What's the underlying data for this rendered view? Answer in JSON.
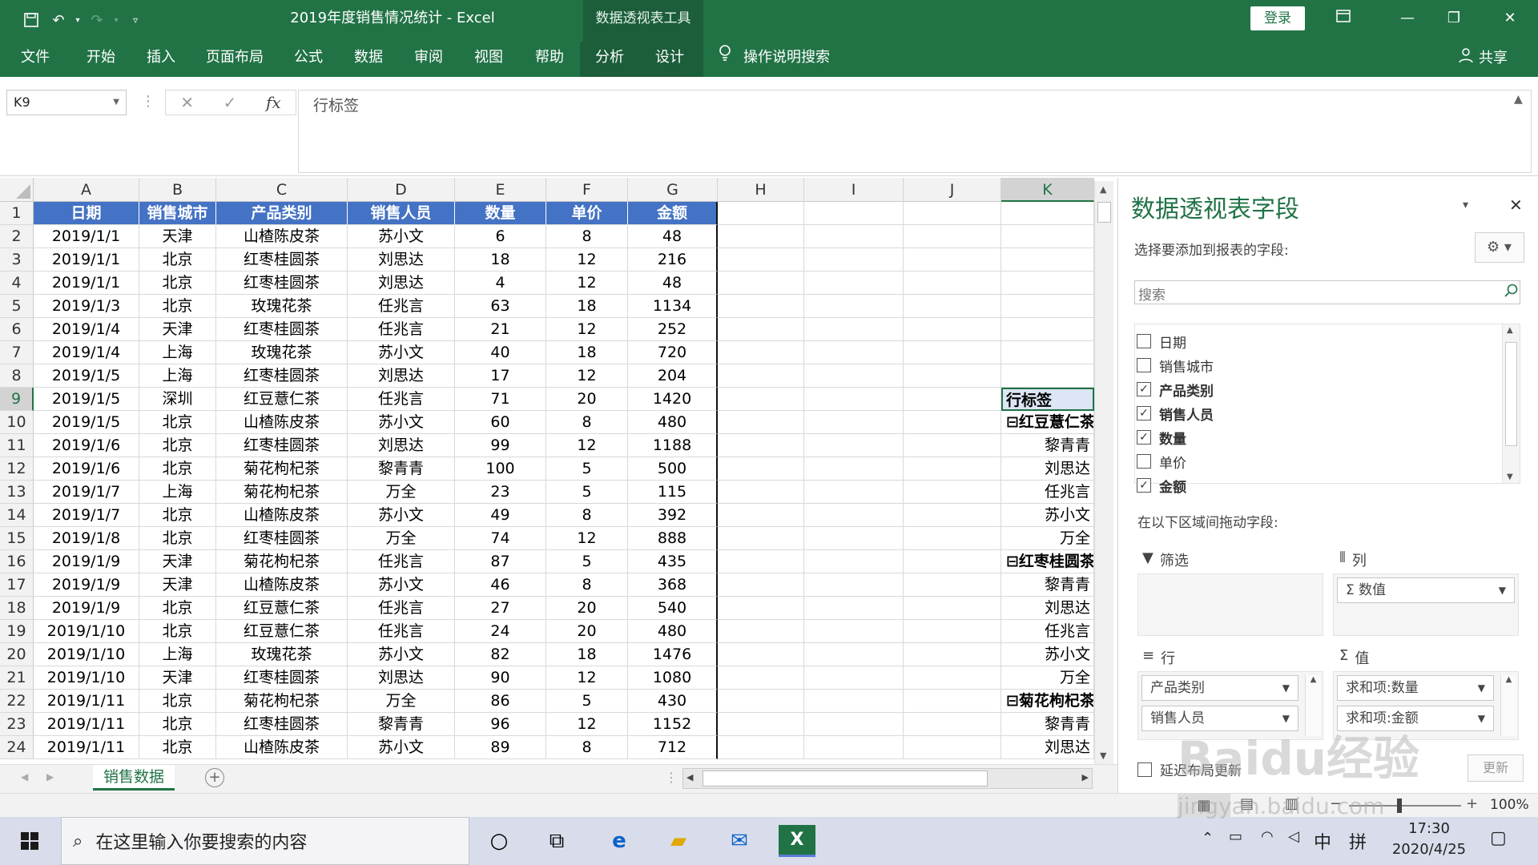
{
  "window": {
    "title": "2019年度销售情况统计 - Excel",
    "context_tool": "数据透视表工具",
    "login": "登录",
    "share": "共享"
  },
  "ribbon": {
    "tabs": [
      "文件",
      "开始",
      "插入",
      "页面布局",
      "公式",
      "数据",
      "审阅",
      "视图",
      "帮助",
      "分析",
      "设计"
    ],
    "tellme": "操作说明搜索"
  },
  "formula": {
    "namebox": "K9",
    "fx": "fx",
    "content": "行标签"
  },
  "grid": {
    "columns": [
      "A",
      "B",
      "C",
      "D",
      "E",
      "F",
      "G",
      "H",
      "I",
      "J",
      "K"
    ],
    "header": [
      "日期",
      "销售城市",
      "产品类别",
      "销售人员",
      "数量",
      "单价",
      "金额"
    ],
    "rows": [
      [
        "2019/1/1",
        "天津",
        "山楂陈皮茶",
        "苏小文",
        "6",
        "8",
        "48"
      ],
      [
        "2019/1/1",
        "北京",
        "红枣桂圆茶",
        "刘思达",
        "18",
        "12",
        "216"
      ],
      [
        "2019/1/1",
        "北京",
        "红枣桂圆茶",
        "刘思达",
        "4",
        "12",
        "48"
      ],
      [
        "2019/1/3",
        "北京",
        "玫瑰花茶",
        "任兆言",
        "63",
        "18",
        "1134"
      ],
      [
        "2019/1/4",
        "天津",
        "红枣桂圆茶",
        "任兆言",
        "21",
        "12",
        "252"
      ],
      [
        "2019/1/4",
        "上海",
        "玫瑰花茶",
        "苏小文",
        "40",
        "18",
        "720"
      ],
      [
        "2019/1/5",
        "上海",
        "红枣桂圆茶",
        "刘思达",
        "17",
        "12",
        "204"
      ],
      [
        "2019/1/5",
        "深圳",
        "红豆薏仁茶",
        "任兆言",
        "71",
        "20",
        "1420"
      ],
      [
        "2019/1/5",
        "北京",
        "山楂陈皮茶",
        "苏小文",
        "60",
        "8",
        "480"
      ],
      [
        "2019/1/6",
        "北京",
        "红枣桂圆茶",
        "刘思达",
        "99",
        "12",
        "1188"
      ],
      [
        "2019/1/6",
        "北京",
        "菊花枸杞茶",
        "黎青青",
        "100",
        "5",
        "500"
      ],
      [
        "2019/1/7",
        "上海",
        "菊花枸杞茶",
        "万全",
        "23",
        "5",
        "115"
      ],
      [
        "2019/1/7",
        "北京",
        "山楂陈皮茶",
        "苏小文",
        "49",
        "8",
        "392"
      ],
      [
        "2019/1/8",
        "北京",
        "红枣桂圆茶",
        "万全",
        "74",
        "12",
        "888"
      ],
      [
        "2019/1/9",
        "天津",
        "菊花枸杞茶",
        "任兆言",
        "87",
        "5",
        "435"
      ],
      [
        "2019/1/9",
        "天津",
        "山楂陈皮茶",
        "苏小文",
        "46",
        "8",
        "368"
      ],
      [
        "2019/1/9",
        "北京",
        "红豆薏仁茶",
        "任兆言",
        "27",
        "20",
        "540"
      ],
      [
        "2019/1/10",
        "北京",
        "红豆薏仁茶",
        "任兆言",
        "24",
        "20",
        "480"
      ],
      [
        "2019/1/10",
        "上海",
        "玫瑰花茶",
        "苏小文",
        "82",
        "18",
        "1476"
      ],
      [
        "2019/1/10",
        "天津",
        "红枣桂圆茶",
        "刘思达",
        "90",
        "12",
        "1080"
      ],
      [
        "2019/1/11",
        "北京",
        "菊花枸杞茶",
        "万全",
        "86",
        "5",
        "430"
      ],
      [
        "2019/1/11",
        "北京",
        "红枣桂圆茶",
        "黎青青",
        "96",
        "12",
        "1152"
      ],
      [
        "2019/1/11",
        "北京",
        "山楂陈皮茶",
        "苏小文",
        "89",
        "8",
        "712"
      ]
    ],
    "pivot": {
      "9": "行标签",
      "10": "⊟红豆薏仁茶",
      "11": "黎青青",
      "12": "刘思达",
      "13": "任兆言",
      "14": "苏小文",
      "15": "万全",
      "16": "⊟红枣桂圆茶",
      "17": "黎青青",
      "18": "刘思达",
      "19": "任兆言",
      "20": "苏小文",
      "21": "万全",
      "22": "⊟菊花枸杞茶",
      "23": "黎青青",
      "24": "刘思达"
    }
  },
  "pane": {
    "title": "数据透视表字段",
    "choose_label": "选择要添加到报表的字段:",
    "search_placeholder": "搜索",
    "fields": [
      {
        "label": "日期",
        "checked": false
      },
      {
        "label": "销售城市",
        "checked": false
      },
      {
        "label": "产品类别",
        "checked": true
      },
      {
        "label": "销售人员",
        "checked": true
      },
      {
        "label": "数量",
        "checked": true
      },
      {
        "label": "单价",
        "checked": false
      },
      {
        "label": "金额",
        "checked": true
      }
    ],
    "drag_label": "在以下区域间拖动字段:",
    "filter_label": "筛选",
    "columns_label": "列",
    "rows_label": "行",
    "values_label": "值",
    "columns_chip": "Σ 数值",
    "rows_chips": [
      "产品类别",
      "销售人员"
    ],
    "values_chips": [
      "求和项:数量",
      "求和项:金额"
    ],
    "defer_label": "延迟布局更新",
    "update_label": "更新"
  },
  "sheet": {
    "tab": "销售数据"
  },
  "status": {
    "zoom": "100%"
  },
  "taskbar": {
    "search_placeholder": "在这里输入你要搜索的内容",
    "time": "17:30",
    "date": "2020/4/25",
    "ime1": "中",
    "ime2": "拼"
  },
  "watermark": {
    "main": "Baidu经验",
    "sub": "jingyan.baidu.com"
  }
}
